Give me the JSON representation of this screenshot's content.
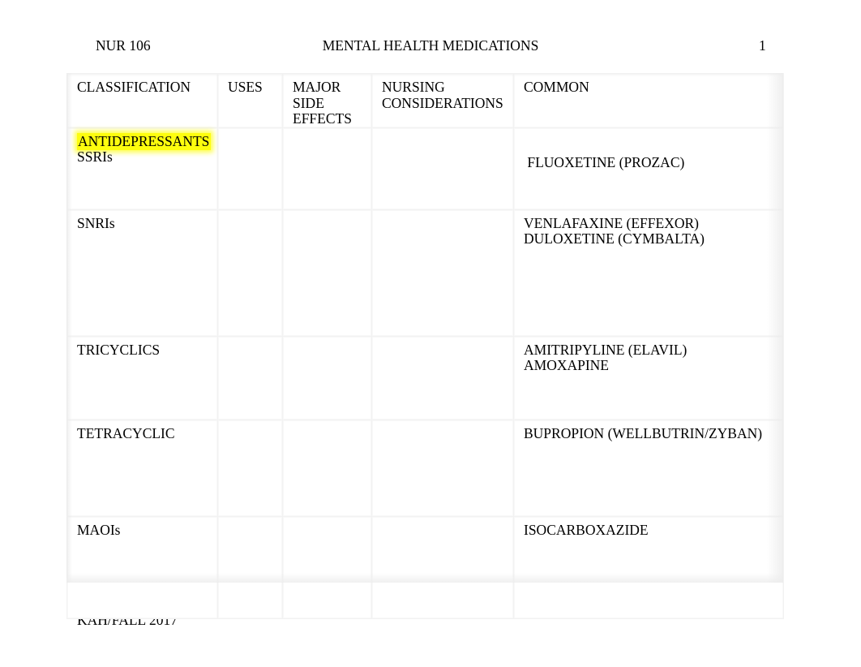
{
  "document": {
    "header": {
      "course": "NUR 106",
      "title": "MENTAL HEALTH MEDICATIONS",
      "page_number": "1"
    },
    "footer": {
      "text": "KAH/FALL 2017"
    },
    "highlight_color": "#fdfd0e",
    "text_color": "#000000",
    "gridline_color": "#f2f2f2"
  },
  "table": {
    "columns": [
      {
        "key": "classification",
        "header": "CLASSIFICATION"
      },
      {
        "key": "uses",
        "header": "USES"
      },
      {
        "key": "side_effects",
        "header_lines": [
          "MAJOR",
          "SIDE",
          "EFFECTS"
        ]
      },
      {
        "key": "nursing",
        "header_lines": [
          "NURSING",
          "CONSIDERATIONS"
        ]
      },
      {
        "key": "common",
        "header": "COMMON"
      }
    ],
    "header_labels": {
      "classification": "CLASSIFICATION",
      "uses": "USES",
      "side_major": "MAJOR",
      "side_side": "SIDE",
      "side_effects": "EFFECTS",
      "nursing_1": "NURSING",
      "nursing_2": "CONSIDERATIONS",
      "common": "COMMON"
    },
    "rows": [
      {
        "id": "ssri",
        "classification_group": "ANTIDEPRESSANTS",
        "classification_group_highlighted": true,
        "classification": "SSRIs",
        "uses": "",
        "side_effects": "",
        "nursing": "",
        "common_1": " FLUOXETINE (PROZAC)",
        "common_2": ""
      },
      {
        "id": "snri",
        "classification": "SNRIs",
        "uses": "",
        "side_effects": "",
        "nursing": "",
        "common_1": "VENLAFAXINE (EFFEXOR)",
        "common_2": "DULOXETINE (CYMBALTA)"
      },
      {
        "id": "tricyclics",
        "classification": "TRICYCLICS",
        "uses": "",
        "side_effects": "",
        "nursing": "",
        "common_1": "AMITRIPYLINE (ELAVIL)",
        "common_2": "AMOXAPINE"
      },
      {
        "id": "tetracyclic",
        "classification": "TETRACYCLIC",
        "uses": "",
        "side_effects": "",
        "nursing": "",
        "common_1": "BUPROPION (WELLBUTRIN/ZYBAN)",
        "common_2": ""
      },
      {
        "id": "maoi",
        "classification": "MAOIs",
        "uses": "",
        "side_effects": "",
        "nursing": "",
        "common_1": "ISOCARBOXAZIDE",
        "common_2": ""
      }
    ]
  }
}
